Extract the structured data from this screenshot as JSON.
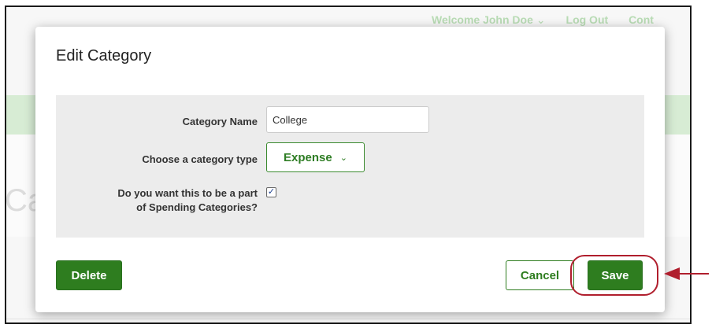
{
  "background": {
    "topnav": {
      "welcome": "Welcome John Doe",
      "logout": "Log Out",
      "contact": "Cont"
    },
    "heading_fragment": "Ca"
  },
  "modal": {
    "title": "Edit Category",
    "fields": {
      "category_name": {
        "label": "Category Name",
        "value": "College"
      },
      "category_type": {
        "label": "Choose a category type",
        "selected": "Expense"
      },
      "spending": {
        "label_line1": "Do you want this to be a part",
        "label_line2": "of Spending Categories?",
        "checked": true
      }
    },
    "buttons": {
      "delete": "Delete",
      "cancel": "Cancel",
      "save": "Save"
    }
  },
  "colors": {
    "primary_green": "#2e7d1f",
    "annotation_red": "#b01e2d"
  }
}
